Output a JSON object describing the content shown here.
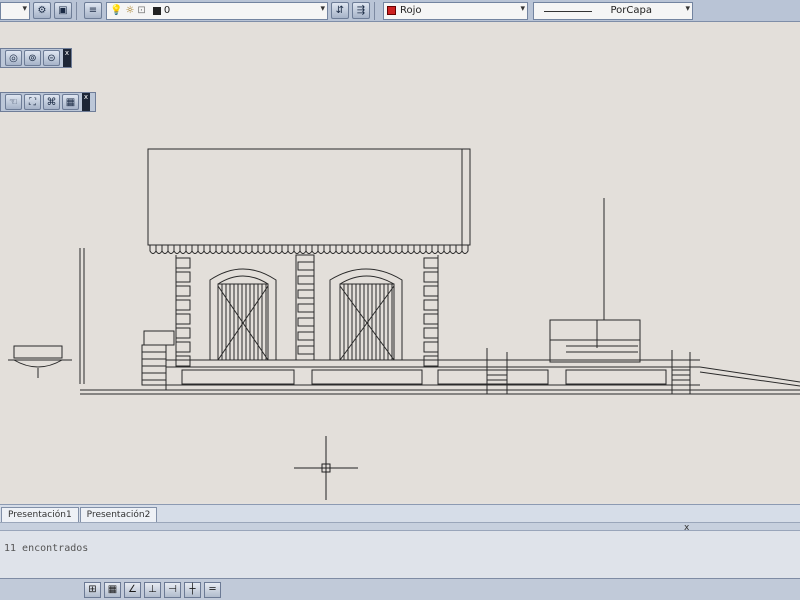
{
  "toolbar": {
    "layer_name": "0",
    "color_value": "Rojo",
    "linetype_value": "PorCapa",
    "color_swatch": "#cc2020",
    "combo_arrow": "▾",
    "icons": [
      "layer-states-icon",
      "lightbulb-icon",
      "sun-icon",
      "lock-icon",
      "layer-color-icon"
    ]
  },
  "floating_toolbars": {
    "close_glyph": "x"
  },
  "tabs": [
    {
      "label": "Presentación1"
    },
    {
      "label": "Presentación2"
    }
  ],
  "command_line": {
    "text": "11 encontrados"
  },
  "crosshair": {
    "color": "#222222"
  }
}
